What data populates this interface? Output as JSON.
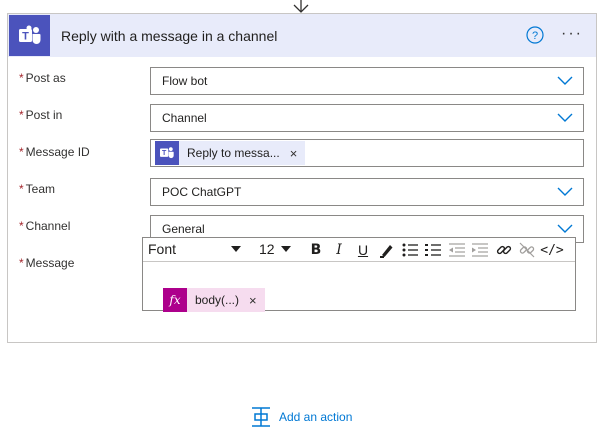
{
  "card": {
    "title": "Reply with a message in a channel",
    "accent": "#4b53bc",
    "header_bg": "#e8ebfa"
  },
  "fields": {
    "post_as": {
      "label": "Post as",
      "value": "Flow bot"
    },
    "post_in": {
      "label": "Post in",
      "value": "Channel"
    },
    "message_id": {
      "label": "Message ID",
      "token": "Reply to messa..."
    },
    "team": {
      "label": "Team",
      "value": "POC ChatGPT"
    },
    "channel": {
      "label": "Channel",
      "value": "General"
    },
    "message": {
      "label": "Message",
      "expression": "body(...)"
    }
  },
  "required_marker": "*",
  "remove_glyph": "×",
  "toolbar": {
    "font": "Font",
    "size": "12",
    "bold": "B",
    "italic": "I",
    "underline": "U",
    "code": "</>"
  },
  "footer": {
    "add_action": "Add an action"
  },
  "icons": [
    "down-arrow-icon",
    "teams-icon",
    "help-icon",
    "more-icon",
    "chevron-down-icon",
    "expression-fx-icon",
    "add-action-icon"
  ]
}
